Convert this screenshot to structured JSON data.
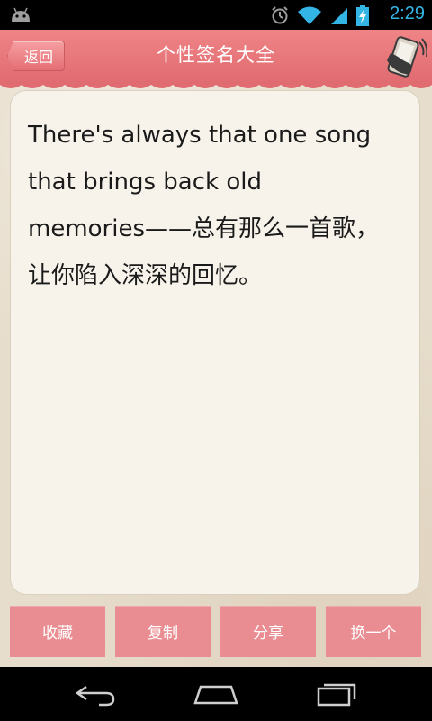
{
  "status_bar": {
    "time": "2:29",
    "icons": [
      "android-icon",
      "alarm-icon",
      "wifi-icon",
      "signal-icon",
      "battery-charging-icon"
    ]
  },
  "header": {
    "back_label": "返回",
    "title": "个性签名大全",
    "shake_icon": "shake-phone-icon"
  },
  "content": {
    "signature": "There's always that one song that brings back old memories——总有那么一首歌，让你陷入深深的回忆。"
  },
  "actions": [
    {
      "label": "收藏"
    },
    {
      "label": "复制"
    },
    {
      "label": "分享"
    },
    {
      "label": "换一个"
    }
  ],
  "nav_bar": {
    "icons": [
      "back-icon",
      "home-icon",
      "recent-apps-icon"
    ]
  },
  "colors": {
    "header": "#e9787c",
    "button": "#ea8d92",
    "card": "#f7f3ea",
    "time": "#33b5e5"
  }
}
